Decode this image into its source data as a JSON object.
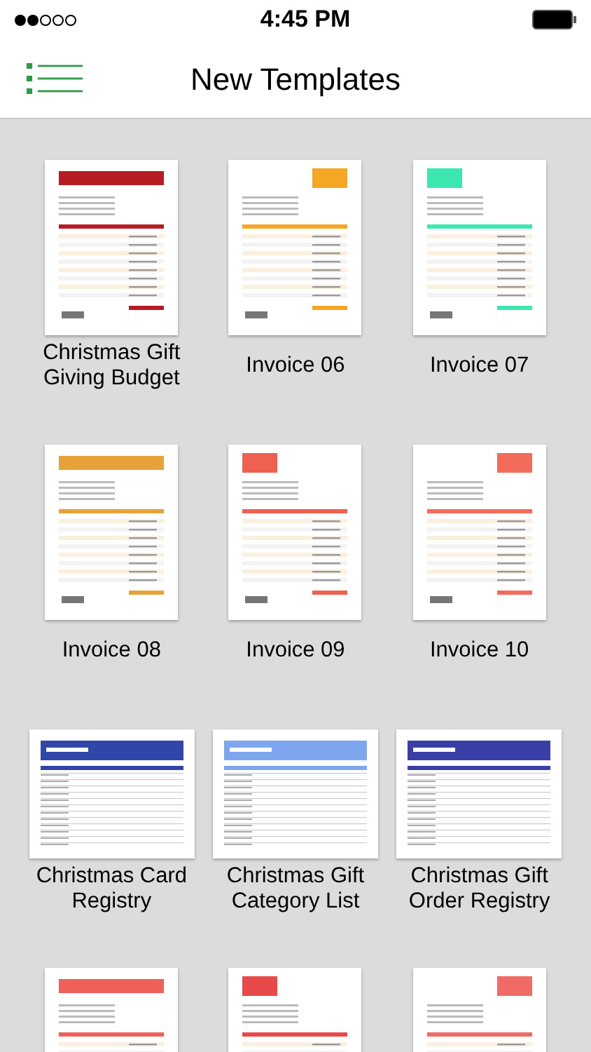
{
  "status_bar": {
    "time": "4:45 PM"
  },
  "nav": {
    "title": "New Templates"
  },
  "templates": [
    {
      "title": "Christmas Gift Giving Budget",
      "kind": "portrait",
      "color": "#b51c24"
    },
    {
      "title": "Invoice 06",
      "kind": "portrait",
      "color": "#f5a623"
    },
    {
      "title": "Invoice 07",
      "kind": "portrait",
      "color": "#3de8b0"
    },
    {
      "title": "Invoice 08",
      "kind": "portrait",
      "color": "#e8a23a"
    },
    {
      "title": "Invoice 09",
      "kind": "portrait",
      "color": "#f06050"
    },
    {
      "title": "Invoice 10",
      "kind": "portrait",
      "color": "#f26b5b"
    },
    {
      "title": "Christmas Card Registry",
      "kind": "landscape",
      "color": "#3046a8"
    },
    {
      "title": "Christmas Gift Category List",
      "kind": "landscape",
      "color": "#7ea6ef"
    },
    {
      "title": "Christmas Gift Order Registry",
      "kind": "landscape",
      "color": "#3a3fa8"
    },
    {
      "kind": "portrait",
      "color": "#f0605a"
    },
    {
      "kind": "portrait",
      "color": "#e84a4a"
    },
    {
      "kind": "portrait",
      "color": "#f06b66"
    }
  ]
}
